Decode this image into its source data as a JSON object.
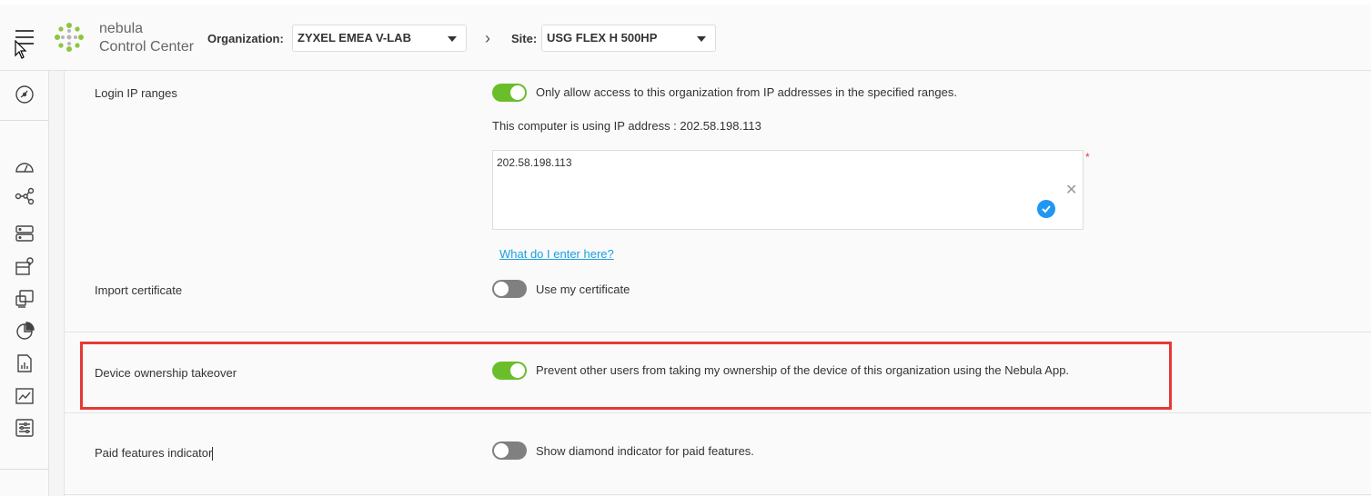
{
  "header": {
    "logo_line1": "nebula",
    "logo_line2": "Control Center",
    "organization_label": "Organization:",
    "organization_value": "ZYXEL EMEA V-LAB",
    "site_label": "Site:",
    "site_value": "USG FLEX H 500HP"
  },
  "sidebar": {
    "icons": [
      "dashboard-icon",
      "speedometer-icon",
      "topology-icon",
      "server-icon",
      "site-location-icon",
      "devices-icon",
      "pie-chart-icon",
      "report-icon",
      "line-chart-icon",
      "settings-sliders-icon"
    ]
  },
  "settings": {
    "login_ip": {
      "label": "Login IP ranges",
      "toggle_on": true,
      "toggle_text": "Only allow access to this organization from IP addresses in the specified ranges.",
      "info": "This computer is using IP address : 202.58.198.113",
      "value": "202.58.198.113",
      "required_mark": "*",
      "help_link": "What do I enter here?"
    },
    "import_cert": {
      "label": "Import certificate",
      "toggle_on": false,
      "toggle_text": "Use my certificate"
    },
    "ownership": {
      "label": "Device ownership takeover",
      "toggle_on": true,
      "toggle_text": "Prevent other users from taking my ownership of the device of this organization using the Nebula App."
    },
    "paid_features": {
      "label": "Paid features indicator",
      "toggle_on": false,
      "toggle_text": "Show diamond indicator for paid features."
    }
  },
  "colors": {
    "toggle_on": "#6bbe2b",
    "toggle_off": "#808080",
    "link": "#1a9fe0",
    "highlight": "#e53935",
    "check": "#2196f3"
  }
}
